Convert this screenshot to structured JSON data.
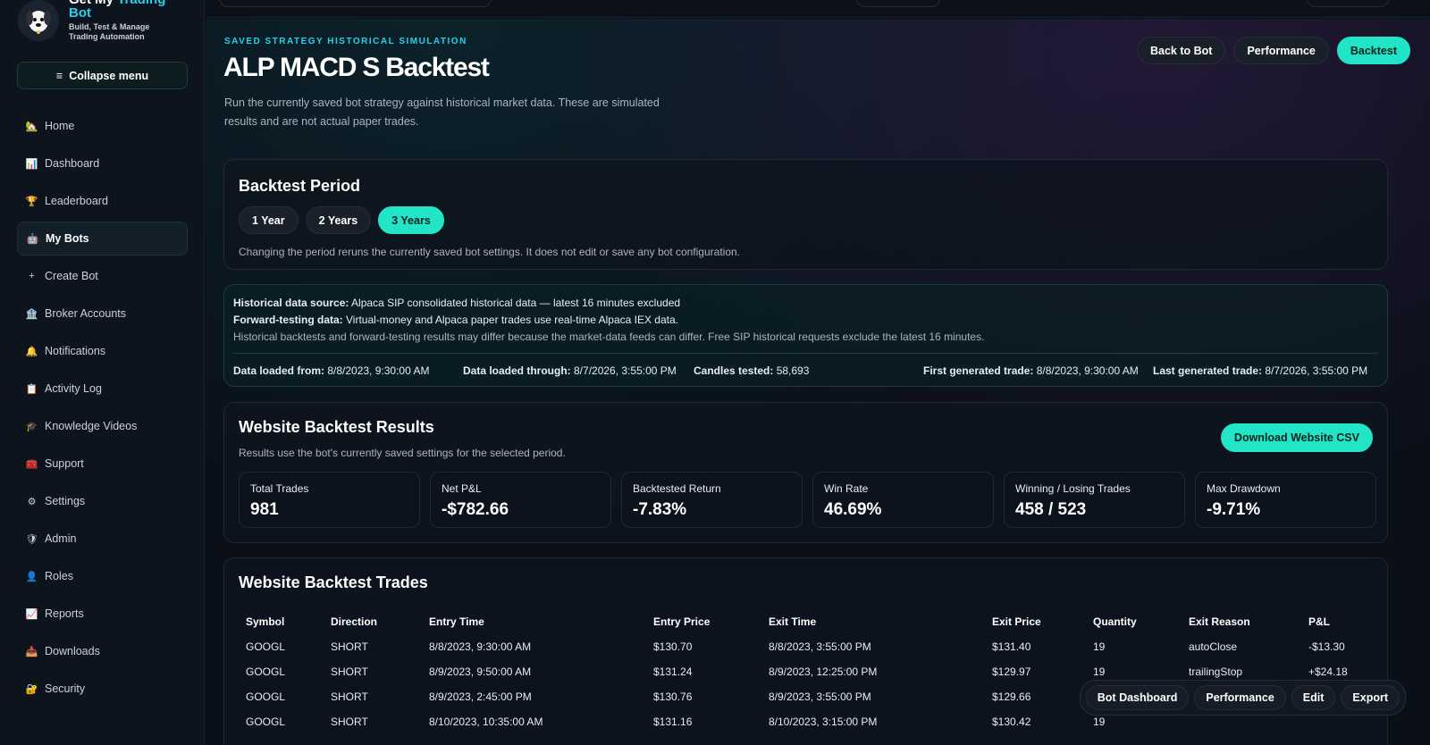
{
  "sidebar": {
    "brand_name_line1": "Get My",
    "brand_name_accent": "Trading",
    "brand_name_line2": "Bot",
    "brand_tagline_1": "Build, Test & Manage",
    "brand_tagline_2": "Trading Automation",
    "collapse_label": "Collapse menu",
    "items": [
      {
        "label": "Home",
        "icon": "house-icon"
      },
      {
        "label": "Dashboard",
        "icon": "chart-icon"
      },
      {
        "label": "Leaderboard",
        "icon": "trophy-icon"
      },
      {
        "label": "My Bots",
        "icon": "robot-icon",
        "active": true
      },
      {
        "label": "Create Bot",
        "icon": "plus-icon"
      },
      {
        "label": "Broker Accounts",
        "icon": "bank-icon"
      },
      {
        "label": "Notifications",
        "icon": "bell-icon"
      },
      {
        "label": "Activity Log",
        "icon": "clipboard-icon"
      },
      {
        "label": "Knowledge Videos",
        "icon": "graduation-cap-icon"
      },
      {
        "label": "Support",
        "icon": "toolbox-icon"
      },
      {
        "label": "Settings",
        "icon": "gear-icon"
      },
      {
        "label": "Admin",
        "icon": "shield-icon"
      },
      {
        "label": "Roles",
        "icon": "person-icon"
      },
      {
        "label": "Reports",
        "icon": "line-chart-icon"
      },
      {
        "label": "Downloads",
        "icon": "download-tray-icon"
      },
      {
        "label": "Security",
        "icon": "lock-icon"
      }
    ]
  },
  "header": {
    "eyebrow": "SAVED STRATEGY HISTORICAL SIMULATION",
    "title": "ALP MACD S Backtest",
    "description": "Run the currently saved bot strategy against historical market data. These are simulated results and are not actual paper trades.",
    "actions": {
      "back": "Back to Bot",
      "performance": "Performance",
      "backtest": "Backtest"
    }
  },
  "period": {
    "title": "Backtest Period",
    "options": [
      "1 Year",
      "2 Years",
      "3 Years"
    ],
    "selected": "3 Years",
    "note": "Changing the period reruns the currently saved bot settings. It does not edit or save any bot configuration."
  },
  "source": {
    "hist_label": "Historical data source:",
    "hist_value": " Alpaca SIP consolidated historical data — latest 16 minutes excluded",
    "fwd_label": "Forward-testing data:",
    "fwd_value": " Virtual-money and Alpaca paper trades use real-time Alpaca IEX data.",
    "note": "Historical backtests and forward-testing results may differ because the market-data feeds can differ. Free SIP historical requests exclude the latest 16 minutes.",
    "loaded_from_label": "Data loaded from:",
    "loaded_from": " 8/8/2023, 9:30:00 AM",
    "loaded_through_label": "Data loaded through:",
    "loaded_through": " 8/7/2026, 3:55:00 PM",
    "candles_label": "Candles tested:",
    "candles": " 58,693",
    "first_trade_label": "First generated trade:",
    "first_trade": " 8/8/2023, 9:30:00 AM",
    "last_trade_label": "Last generated trade:",
    "last_trade": " 8/7/2026, 3:55:00 PM"
  },
  "results": {
    "title": "Website Backtest Results",
    "subtitle": "Results use the bot's currently saved settings for the selected period.",
    "csv_button": "Download Website CSV",
    "stats": [
      {
        "label": "Total Trades",
        "value": "981"
      },
      {
        "label": "Net P&L",
        "value": "-$782.66"
      },
      {
        "label": "Backtested Return",
        "value": "-7.83%"
      },
      {
        "label": "Win Rate",
        "value": "46.69%"
      },
      {
        "label": "Winning / Losing Trades",
        "value": "458 / 523"
      },
      {
        "label": "Max Drawdown",
        "value": "-9.71%"
      }
    ]
  },
  "trades": {
    "title": "Website Backtest Trades",
    "columns": [
      "Symbol",
      "Direction",
      "Entry Time",
      "Entry Price",
      "Exit Time",
      "Exit Price",
      "Quantity",
      "Exit Reason",
      "P&L"
    ],
    "rows": [
      [
        "GOOGL",
        "SHORT",
        "8/8/2023, 9:30:00 AM",
        "$130.70",
        "8/8/2023, 3:55:00 PM",
        "$131.40",
        "19",
        "autoClose",
        "-$13.30"
      ],
      [
        "GOOGL",
        "SHORT",
        "8/9/2023, 9:50:00 AM",
        "$131.24",
        "8/9/2023, 12:25:00 PM",
        "$129.97",
        "19",
        "trailingStop",
        "+$24.18"
      ],
      [
        "GOOGL",
        "SHORT",
        "8/9/2023, 2:45:00 PM",
        "$130.76",
        "8/9/2023, 3:55:00 PM",
        "$129.66",
        "19",
        "",
        ""
      ],
      [
        "GOOGL",
        "SHORT",
        "8/10/2023, 10:35:00 AM",
        "$131.16",
        "8/10/2023, 3:15:00 PM",
        "$130.42",
        "19",
        "",
        ""
      ]
    ]
  },
  "float_actions": {
    "dashboard": "Bot Dashboard",
    "performance": "Performance",
    "edit": "Edit",
    "export": "Export"
  }
}
